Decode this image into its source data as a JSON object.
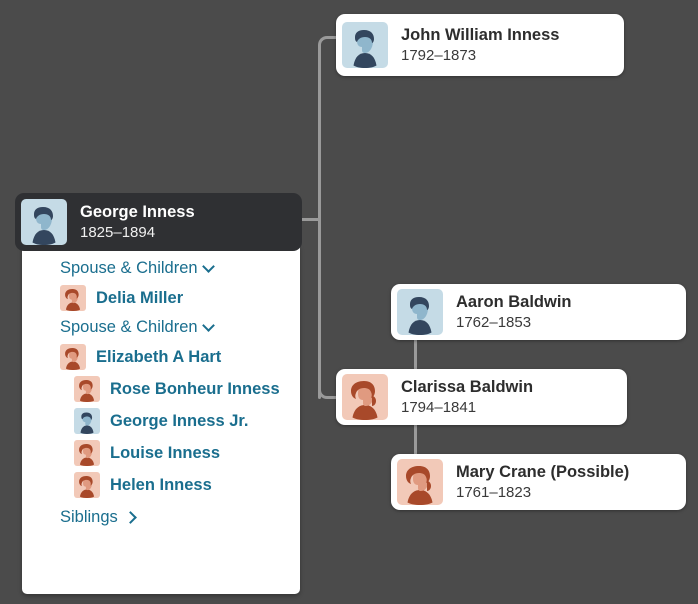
{
  "theme": {
    "background": "#4b4b4b",
    "card_background": "#ffffff",
    "selected_card_background": "#2f3033",
    "link_color": "#1a6e8e",
    "connector_color": "#9a9a9a",
    "avatar_male_bg": "#c5dbe6",
    "avatar_male_hair": "#33465e",
    "avatar_male_face": "#8fb6cc",
    "avatar_female_bg": "#f2c9b8",
    "avatar_female_hair": "#a8492a",
    "avatar_female_face": "#e09a80"
  },
  "cards": {
    "father": {
      "name": "John William Inness",
      "years": "1792–1873",
      "gender": "male"
    },
    "focus": {
      "name": "George Inness",
      "years": "1825–1894",
      "gender": "male"
    },
    "grandfather": {
      "name": "Aaron Baldwin",
      "years": "1762–1853",
      "gender": "male"
    },
    "mother": {
      "name": "Clarissa Baldwin",
      "years": "1794–1841",
      "gender": "female"
    },
    "grandmother": {
      "name": "Mary Crane (Possible)",
      "years": "1761–1823",
      "gender": "female"
    }
  },
  "panel": {
    "groups": [
      {
        "header": "Spouse & Children",
        "chevron": "chevron-down-icon",
        "members": [
          {
            "name": "Delia Miller",
            "gender": "female",
            "role": "spouse"
          }
        ]
      },
      {
        "header": "Spouse & Children",
        "chevron": "chevron-down-icon",
        "members": [
          {
            "name": "Elizabeth A Hart",
            "gender": "female",
            "role": "spouse"
          },
          {
            "name": "Rose Bonheur Inness",
            "gender": "female",
            "role": "child"
          },
          {
            "name": "George Inness Jr.",
            "gender": "male",
            "role": "child"
          },
          {
            "name": "Louise Inness",
            "gender": "female",
            "role": "child"
          },
          {
            "name": "Helen Inness",
            "gender": "female",
            "role": "child"
          }
        ]
      }
    ],
    "siblings_label": "Siblings",
    "siblings_chevron": "chevron-right-icon"
  }
}
